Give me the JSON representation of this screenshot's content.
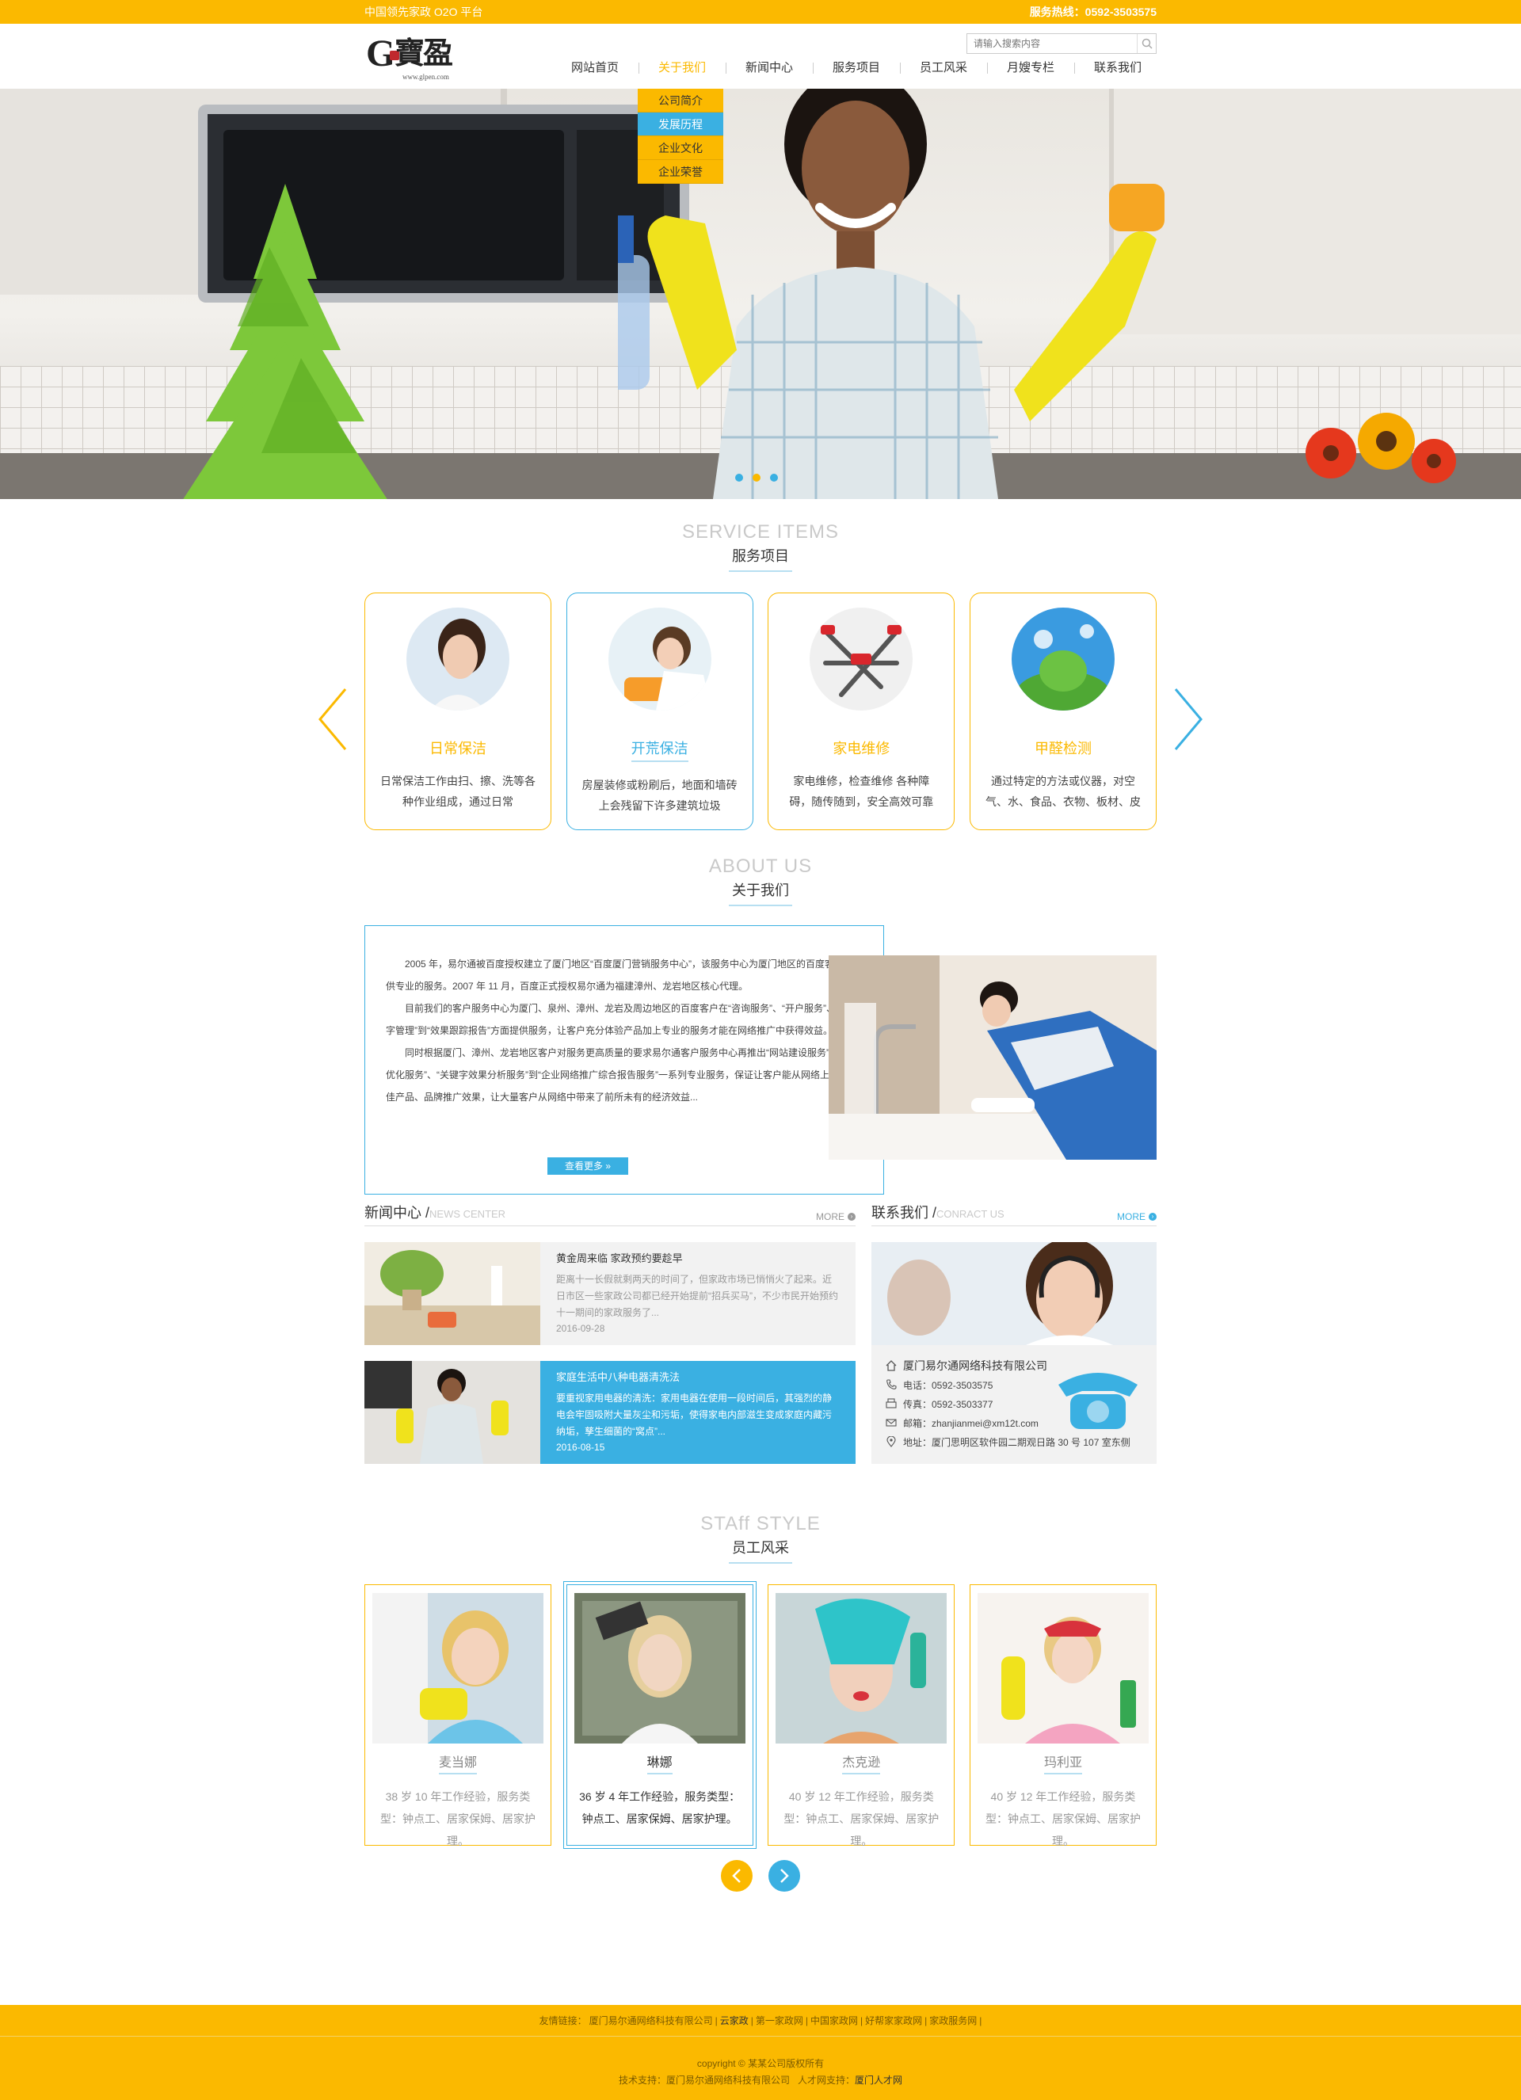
{
  "topbar": {
    "slogan": "中国领先家政 O2O 平台",
    "hotline": "服务热线：0592-3503575"
  },
  "header": {
    "logo_letter": "G",
    "logo_cn": "寶盈",
    "logo_url": "www.glpen.com",
    "search_placeholder": "请输入搜索内容",
    "nav": [
      "网站首页",
      "关于我们",
      "新闻中心",
      "服务项目",
      "员工风采",
      "月嫂专栏",
      "联系我们"
    ],
    "dropdown": [
      "公司简介",
      "发展历程",
      "企业文化",
      "企业荣誉"
    ]
  },
  "services": {
    "title_en": "SERVICE ITEMS",
    "title_cn": "服务项目",
    "items": [
      {
        "name": "日常保洁",
        "desc": "日常保洁工作由扫、擦、洗等各种作业组成，通过日常"
      },
      {
        "name": "开荒保洁",
        "desc": "房屋装修或粉刷后，地面和墙砖上会残留下许多建筑垃圾"
      },
      {
        "name": "家电维修",
        "desc": "家电维修，检查维修 各种障碍，随传随到，安全高效可靠"
      },
      {
        "name": "甲醛检测",
        "desc": "通过特定的方法或仪器，对空气、水、食品、衣物、板材、皮"
      }
    ]
  },
  "about": {
    "title_en": "ABOUT US",
    "title_cn": "关于我们",
    "p1": "2005 年，易尔通被百度授权建立了厦门地区“百度厦门营销服务中心”，该服务中心为厦门地区的百度客户提供专业的服务。2007 年 11 月，百度正式授权易尔通为福建漳州、龙岩地区核心代理。",
    "p2": "目前我们的客户服务中心为厦门、泉州、漳州、龙岩及周边地区的百度客户在“咨询服务”、“开户服务”、“关键字管理”到“效果跟踪报告”方面提供服务，让客户充分体验产品加上专业的服务才能在网络推广中获得效益。",
    "p3": "同时根据厦门、漳州、龙岩地区客户对服务更高质量的要求易尔通客户服务中心再推出“网站建设服务”、“网站优化服务”、“关键字效果分析服务”到“企业网络推广综合报告服务”一系列专业服务，保证让客户能从网络上获得最佳产品、品牌推广效果，让大量客户从网络中带来了前所未有的经济效益...",
    "more": "查看更多 »"
  },
  "news": {
    "title": "新闻中心 /",
    "title_en": "NEWS CENTER",
    "more": "MORE",
    "items": [
      {
        "title": "黄金周来临 家政预约要趁早",
        "desc": "距离十一长假就剩两天的时间了，但家政市场已悄悄火了起来。近日市区一些家政公司都已经开始提前“招兵买马”，不少市民开始预约十一期间的家政服务了...",
        "date": "2016-09-28"
      },
      {
        "title": "家庭生活中八种电器清洗法",
        "desc": "要重视家用电器的清洗：家用电器在使用一段时间后，其强烈的静电会牢固吸附大量灰尘和污垢，使得家电内部滋生变成家庭内藏污纳垢，孳生细菌的“窝点”...",
        "date": "2016-08-15"
      }
    ]
  },
  "contact": {
    "title": "联系我们 /",
    "title_en": "CONRACT US",
    "more": "MORE",
    "company": "厦门易尔通网络科技有限公司",
    "tel": "电话：0592-3503575",
    "fax": "传真：0592-3503377",
    "email": "邮箱：zhanjianmei@xm12t.com",
    "address": "地址：厦门思明区软件园二期观日路 30 号 107 室东侧"
  },
  "staff": {
    "title_en": "STAff STYLE",
    "title_cn": "员工风采",
    "items": [
      {
        "name": "麦当娜",
        "desc": "38 岁  10 年工作经验，服务类型：钟点工、居家保姆、居家护理。"
      },
      {
        "name": "琳娜",
        "desc": "36 岁  4 年工作经验，服务类型：钟点工、居家保姆、居家护理。"
      },
      {
        "name": "杰克逊",
        "desc": "40 岁  12 年工作经验，服务类型：钟点工、居家保姆、居家护理。"
      },
      {
        "name": "玛利亚",
        "desc": "40 岁  12 年工作经验，服务类型：钟点工、居家保姆、居家护理。"
      }
    ]
  },
  "footer": {
    "links_label": "友情链接：",
    "links": [
      "厦门易尔通网络科技有限公司",
      "云家政",
      "第一家政网",
      "中国家政网",
      "好帮家家政网",
      "家政服务网"
    ],
    "copyright": "copyright © 某某公司版权所有",
    "support_label": "技术支持：",
    "support": "厦门易尔通网络科技有限公司",
    "talent_label": "人才网支持：",
    "talent": "厦门人才网"
  },
  "colors": {
    "accent_yellow": "#fbb900",
    "accent_blue": "#3ab0e2"
  }
}
